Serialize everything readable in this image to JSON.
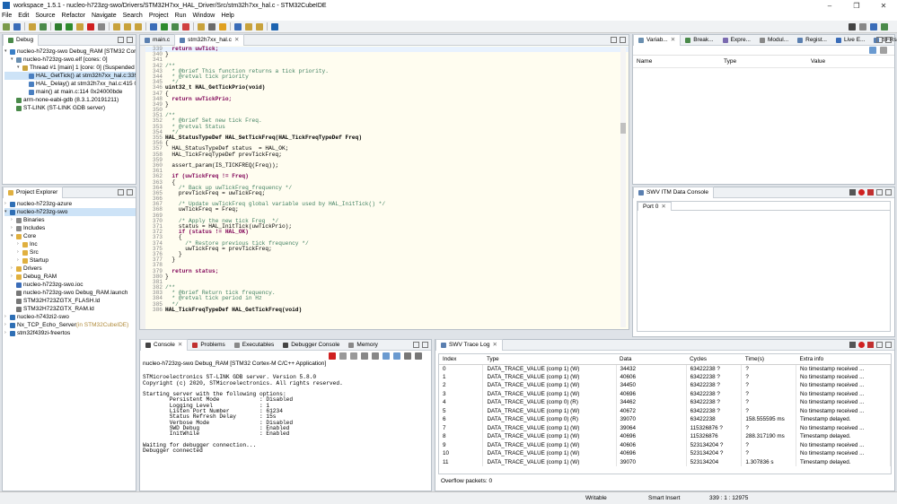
{
  "window": {
    "title": "workspace_1.5.1 - nucleo-h723zg-swo/Drivers/STM32H7xx_HAL_Driver/Src/stm32h7xx_hal.c - STM32CubeIDE"
  },
  "menu": [
    "File",
    "Edit",
    "Source",
    "Refactor",
    "Navigate",
    "Search",
    "Project",
    "Run",
    "Window",
    "Help"
  ],
  "debug_view": {
    "tab": "Debug",
    "items": [
      {
        "label": "nucleo-h723zg-swo Debug_RAM [STM32 Cortex-M C/C++ Application]",
        "indent": 0,
        "arrow": "▾",
        "icon": "#3a7fc6"
      },
      {
        "label": "nucleo-h723zg-swo.elf [cores: 0]",
        "indent": 1,
        "arrow": "▾",
        "icon": "#6a8fb0"
      },
      {
        "label": "Thread #1 [main] 1 [core: 0] (Suspended : Breakpoint)",
        "indent": 2,
        "arrow": "▾",
        "icon": "#c8a23c"
      },
      {
        "label": "HAL_GetTick() at stm32h7xx_hal.c:339",
        "indent": 3,
        "arrow": "",
        "icon": "#4a7fc0",
        "selected": true
      },
      {
        "label": "HAL_Delay() at stm32h7xx_hal.c:415 0x",
        "indent": 3,
        "arrow": "",
        "icon": "#4a7fc0"
      },
      {
        "label": "main() at main.c:114 0x24000bde",
        "indent": 3,
        "arrow": "",
        "icon": "#4a7fc0"
      },
      {
        "label": "arm-none-eabi-gdb (8.3.1.20191211)",
        "indent": 1,
        "arrow": "",
        "icon": "#4a8a4a"
      },
      {
        "label": "ST-LINK (ST-LINK GDB server)",
        "indent": 1,
        "arrow": "",
        "icon": "#4a8a4a"
      }
    ]
  },
  "project_explorer": {
    "tab": "Project Explorer",
    "items": [
      {
        "label": "nucleo-h723zg-azure",
        "indent": 0,
        "arrow": "›",
        "icon": "#2f6fb5"
      },
      {
        "label": "nucleo-h723zg-swo",
        "indent": 0,
        "arrow": "▾",
        "icon": "#2f6fb5",
        "selected": true
      },
      {
        "label": "Binaries",
        "indent": 1,
        "arrow": "›",
        "icon": "#8a8a8a"
      },
      {
        "label": "Includes",
        "indent": 1,
        "arrow": "›",
        "icon": "#8a8a8a"
      },
      {
        "label": "Core",
        "indent": 1,
        "arrow": "▾",
        "icon": "#e0b040"
      },
      {
        "label": "Inc",
        "indent": 2,
        "arrow": "›",
        "icon": "#e0b040"
      },
      {
        "label": "Src",
        "indent": 2,
        "arrow": "›",
        "icon": "#e0b040"
      },
      {
        "label": "Startup",
        "indent": 2,
        "arrow": "›",
        "icon": "#e0b040"
      },
      {
        "label": "Drivers",
        "indent": 1,
        "arrow": "›",
        "icon": "#e0b040"
      },
      {
        "label": "Debug_RAM",
        "indent": 1,
        "arrow": "›",
        "icon": "#e0b040"
      },
      {
        "label": "nucleo-h723zg-swo.ioc",
        "indent": 1,
        "arrow": "",
        "icon": "#3a6cb8"
      },
      {
        "label": "nucleo-h723zg-swo Debug_RAM.launch",
        "indent": 1,
        "arrow": "",
        "icon": "#777"
      },
      {
        "label": "STM32H723ZGTX_FLASH.ld",
        "indent": 1,
        "arrow": "",
        "icon": "#777"
      },
      {
        "label": "STM32H723ZGTX_RAM.ld",
        "indent": 1,
        "arrow": "",
        "icon": "#777"
      },
      {
        "label": "nucleo-h743zi2-swo",
        "indent": 0,
        "arrow": "›",
        "icon": "#2f6fb5"
      },
      {
        "label": "Nx_TCP_Echo_Server",
        "suffix": " (in STM32CubeIDE)",
        "indent": 0,
        "arrow": "›",
        "icon": "#2f6fb5"
      },
      {
        "label": "stm32f439zi-freertos",
        "indent": 0,
        "arrow": "›",
        "icon": "#2f6fb5"
      }
    ]
  },
  "editor": {
    "tabs": [
      "main.c",
      "stm32h7xx_hal.c"
    ],
    "lines": [
      {
        "n": "339",
        "t": "  return uwTick;",
        "s": "k"
      },
      {
        "n": "340",
        "t": "}",
        "s": ""
      },
      {
        "n": "341",
        "t": "",
        "s": ""
      },
      {
        "n": "342",
        "t": "/**",
        "s": "c"
      },
      {
        "n": "343",
        "t": "  * @brief This function returns a tick priority.",
        "s": "c"
      },
      {
        "n": "344",
        "t": "  * @retval tick priority",
        "s": "c"
      },
      {
        "n": "345",
        "t": "  */",
        "s": "c"
      },
      {
        "n": "346",
        "t": "uint32_t HAL_GetTickPrio(void)",
        "s": "f"
      },
      {
        "n": "347",
        "t": "{",
        "s": ""
      },
      {
        "n": "348",
        "t": "  return uwTickPrio;",
        "s": "k"
      },
      {
        "n": "349",
        "t": "}",
        "s": ""
      },
      {
        "n": "350",
        "t": "",
        "s": ""
      },
      {
        "n": "351",
        "t": "/**",
        "s": "c"
      },
      {
        "n": "352",
        "t": "  * @brief Set new tick Freq.",
        "s": "c"
      },
      {
        "n": "353",
        "t": "  * @retval Status",
        "s": "c"
      },
      {
        "n": "354",
        "t": "  */",
        "s": "c"
      },
      {
        "n": "355",
        "t": "HAL_StatusTypeDef HAL_SetTickFreq(HAL_TickFreqTypeDef Freq)",
        "s": "f"
      },
      {
        "n": "356",
        "t": "{",
        "s": ""
      },
      {
        "n": "357",
        "t": "  HAL_StatusTypeDef status  = HAL_OK;",
        "s": "m"
      },
      {
        "n": "358",
        "t": "  HAL_TickFreqTypeDef prevTickFreq;",
        "s": ""
      },
      {
        "n": "359",
        "t": "",
        "s": ""
      },
      {
        "n": "360",
        "t": "  assert_param(IS_TICKFREQ(Freq));",
        "s": ""
      },
      {
        "n": "361",
        "t": "",
        "s": ""
      },
      {
        "n": "362",
        "t": "  if (uwTickFreq != Freq)",
        "s": "k"
      },
      {
        "n": "363",
        "t": "  {",
        "s": ""
      },
      {
        "n": "364",
        "t": "    /* Back up uwTickFreq frequency */",
        "s": "c"
      },
      {
        "n": "365",
        "t": "    prevTickFreq = uwTickFreq;",
        "s": ""
      },
      {
        "n": "366",
        "t": "",
        "s": ""
      },
      {
        "n": "367",
        "t": "    /* Update uwTickFreq global variable used by HAL_InitTick() */",
        "s": "c"
      },
      {
        "n": "368",
        "t": "    uwTickFreq = Freq;",
        "s": ""
      },
      {
        "n": "369",
        "t": "",
        "s": ""
      },
      {
        "n": "370",
        "t": "    /* Apply the new tick Freq  */",
        "s": "c"
      },
      {
        "n": "371",
        "t": "    status = HAL_InitTick(uwTickPrio);",
        "s": ""
      },
      {
        "n": "372",
        "t": "    if (status != HAL_OK)",
        "s": "k"
      },
      {
        "n": "373",
        "t": "    {",
        "s": ""
      },
      {
        "n": "374",
        "t": "      /* Restore previous tick frequency */",
        "s": "c"
      },
      {
        "n": "375",
        "t": "      uwTickFreq = prevTickFreq;",
        "s": ""
      },
      {
        "n": "376",
        "t": "    }",
        "s": ""
      },
      {
        "n": "377",
        "t": "  }",
        "s": ""
      },
      {
        "n": "378",
        "t": "",
        "s": ""
      },
      {
        "n": "379",
        "t": "  return status;",
        "s": "k"
      },
      {
        "n": "380",
        "t": "}",
        "s": ""
      },
      {
        "n": "381",
        "t": "",
        "s": ""
      },
      {
        "n": "382",
        "t": "/**",
        "s": "c"
      },
      {
        "n": "383",
        "t": "  * @brief Return tick frequency.",
        "s": "c"
      },
      {
        "n": "384",
        "t": "  * @retval tick period in Hz",
        "s": "c"
      },
      {
        "n": "385",
        "t": "  */",
        "s": "c"
      },
      {
        "n": "386",
        "t": "HAL_TickFreqTypeDef HAL_GetTickFreq(void)",
        "s": "f"
      }
    ]
  },
  "variables": {
    "tabs": [
      "Variab...",
      "Break...",
      "Expre...",
      "Modul...",
      "Regist...",
      "Live E...",
      "SFRs"
    ],
    "columns": [
      "Name",
      "Type",
      "Value"
    ]
  },
  "swv_console": {
    "title": "SWV ITM Data Console",
    "port_tab": "Port 0"
  },
  "console": {
    "tabs": [
      "Console",
      "Problems",
      "Executables",
      "Debugger Console",
      "Memory"
    ],
    "header": "nucleo-h723zg-swo Debug_RAM [STM32 Cortex-M C/C++ Application]",
    "lines": [
      "",
      "STMicroelectronics ST-LINK GDB server. Version 5.8.0",
      "Copyright (c) 2020, STMicroelectronics. All rights reserved.",
      "",
      "Starting server with the following options:",
      "        Persistent Mode            : Disabled",
      "        Logging Level              : 1",
      "        Listen Port Number         : 61234",
      "        Status Refresh Delay       : 15s",
      "        Verbose Mode               : Disabled",
      "        SWD Debug                  : Enabled",
      "        InitWhile                  : Enabled",
      "",
      "Waiting for debugger connection...",
      "Debugger connected"
    ]
  },
  "trace_log": {
    "tab": "SWV Trace Log",
    "columns": [
      "Index",
      "Type",
      "Data",
      "Cycles",
      "Time(s)",
      "Extra info"
    ],
    "rows": [
      [
        "0",
        "DATA_TRACE_VALUE (comp 1) (W)",
        "34432",
        "63422238 ?",
        "?",
        "No timestamp received ..."
      ],
      [
        "1",
        "DATA_TRACE_VALUE (comp 1) (W)",
        "40606",
        "63422238 ?",
        "?",
        "No timestamp received ..."
      ],
      [
        "2",
        "DATA_TRACE_VALUE (comp 1) (W)",
        "34450",
        "63422238 ?",
        "?",
        "No timestamp received ..."
      ],
      [
        "3",
        "DATA_TRACE_VALUE (comp 1) (W)",
        "40696",
        "63422238 ?",
        "?",
        "No timestamp received ..."
      ],
      [
        "4",
        "DATA_TRACE_VALUE (comp 0) (R)",
        "34462",
        "63422238 ?",
        "?",
        "No timestamp received ..."
      ],
      [
        "5",
        "DATA_TRACE_VALUE (comp 1) (W)",
        "40672",
        "63422238 ?",
        "?",
        "No timestamp received ..."
      ],
      [
        "6",
        "DATA_TRACE_VALUE (comp 0) (R)",
        "39070",
        "63422238",
        "158.555595 ms",
        "Timestamp delayed."
      ],
      [
        "7",
        "DATA_TRACE_VALUE (comp 1) (W)",
        "39064",
        "115326876 ?",
        "?",
        "No timestamp received ..."
      ],
      [
        "8",
        "DATA_TRACE_VALUE (comp 1) (W)",
        "40696",
        "115326876",
        "288.317190 ms",
        "Timestamp delayed."
      ],
      [
        "9",
        "DATA_TRACE_VALUE (comp 1) (W)",
        "40606",
        "523134204 ?",
        "?",
        "No timestamp received ..."
      ],
      [
        "10",
        "DATA_TRACE_VALUE (comp 1) (W)",
        "40696",
        "523134204 ?",
        "?",
        "No timestamp received ..."
      ],
      [
        "11",
        "DATA_TRACE_VALUE (comp 1) (W)",
        "39070",
        "523134204",
        "1.307836 s",
        "Timestamp delayed."
      ]
    ],
    "overflow": "Overflow packets: 0"
  },
  "status": {
    "writable": "Writable",
    "insert": "Smart Insert",
    "position": "339 : 1 : 12975"
  }
}
